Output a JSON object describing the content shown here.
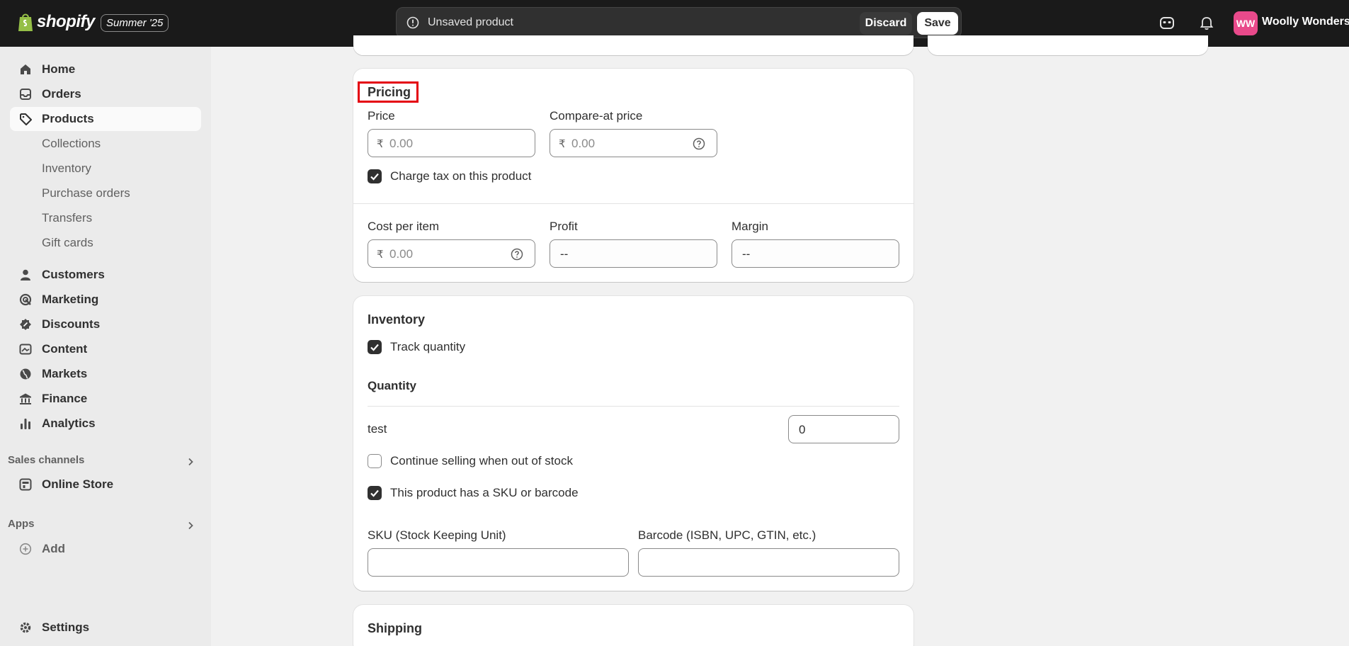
{
  "topbar": {
    "brand": "shopify",
    "edition": "Summer '25",
    "unsaved_text": "Unsaved product",
    "discard_label": "Discard",
    "save_label": "Save",
    "avatar_initials": "WW",
    "store_name": "Woolly Wonders",
    "avatar_color": "#e94a8b"
  },
  "sidebar": {
    "items": [
      {
        "label": "Home",
        "icon": "home-icon"
      },
      {
        "label": "Orders",
        "icon": "inbox-icon"
      },
      {
        "label": "Products",
        "icon": "tag-icon",
        "active": true
      },
      {
        "label": "Collections"
      },
      {
        "label": "Inventory"
      },
      {
        "label": "Purchase orders"
      },
      {
        "label": "Transfers"
      },
      {
        "label": "Gift cards"
      },
      {
        "label": "Customers",
        "icon": "person-icon"
      },
      {
        "label": "Marketing",
        "icon": "target-icon"
      },
      {
        "label": "Discounts",
        "icon": "discount-icon"
      },
      {
        "label": "Content",
        "icon": "image-icon"
      },
      {
        "label": "Markets",
        "icon": "globe-icon"
      },
      {
        "label": "Finance",
        "icon": "bank-icon"
      },
      {
        "label": "Analytics",
        "icon": "chart-icon"
      }
    ],
    "sales_channels_label": "Sales channels",
    "online_store_label": "Online Store",
    "apps_label": "Apps",
    "add_label": "Add",
    "settings_label": "Settings"
  },
  "pricing": {
    "title": "Pricing",
    "price_label": "Price",
    "price_value": "0.00",
    "compare_label": "Compare-at price",
    "compare_value": "0.00",
    "currency": "₹",
    "charge_tax_label": "Charge tax on this product",
    "charge_tax_checked": true,
    "cost_label": "Cost per item",
    "cost_value": "0.00",
    "profit_label": "Profit",
    "profit_value": "--",
    "margin_label": "Margin",
    "margin_value": "--"
  },
  "inventory": {
    "title": "Inventory",
    "track_label": "Track quantity",
    "track_checked": true,
    "quantity_heading": "Quantity",
    "location_name": "test",
    "location_qty": "0",
    "continue_label": "Continue selling when out of stock",
    "continue_checked": false,
    "sku_toggle_label": "This product has a SKU or barcode",
    "sku_toggle_checked": true,
    "sku_label": "SKU (Stock Keeping Unit)",
    "sku_value": "",
    "barcode_label": "Barcode (ISBN, UPC, GTIN, etc.)",
    "barcode_value": ""
  },
  "shipping": {
    "title": "Shipping"
  }
}
